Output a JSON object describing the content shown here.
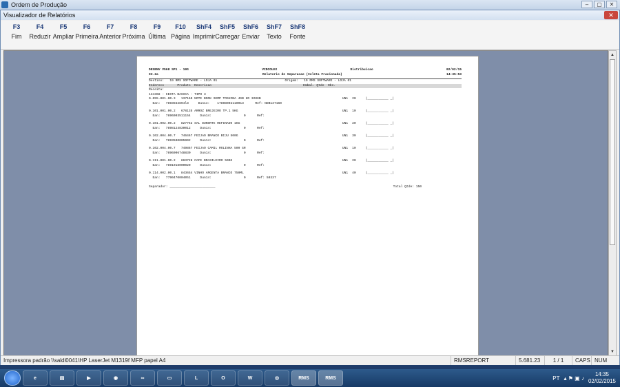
{
  "outer_window": {
    "title": "Ordem de Produção"
  },
  "dialog": {
    "title": "Visualizador de Relatórios"
  },
  "toolbar": [
    {
      "key": "F3",
      "label": "Fim"
    },
    {
      "key": "F4",
      "label": "Reduzir"
    },
    {
      "key": "F5",
      "label": "Ampliar"
    },
    {
      "key": "F6",
      "label": "Primeira"
    },
    {
      "key": "F7",
      "label": "Anterior"
    },
    {
      "key": "F8",
      "label": "Próxima"
    },
    {
      "key": "F9",
      "label": "Última"
    },
    {
      "key": "F10",
      "label": "Página"
    },
    {
      "key": "ShF4",
      "label": "Imprimir"
    },
    {
      "key": "ShF5",
      "label": "Carregar"
    },
    {
      "key": "ShF6",
      "label": "Enviar"
    },
    {
      "key": "ShF7",
      "label": "Texto"
    },
    {
      "key": "ShF8",
      "label": "Fonte"
    }
  ],
  "report": {
    "header_left_1": "DESENV V568 SP1 - 10G",
    "header_mid_1": "VCDCOLEX",
    "header_right_1a": "Distribuicao",
    "header_date": "02/02/15",
    "header_left_2": "03.2a",
    "header_right_2a": "Relatorio de Separacao (Coleta Fracionada)",
    "header_time": "14:35:53",
    "destino": "Destino:   19 RMS SOFTWARE - LOJA 01",
    "origem": "Origem:   19 RMS SOFTWARE - LOJA 01",
    "columns": "Endereco       Produto  Descricao",
    "columns_right": "Embal. Qtde  Obs.",
    "receita": "Receita:",
    "group": "134368 - CESTA  BASICA -  TIPO 3",
    "items": [
      {
        "line1": "0.055.001.00.3   137160 NOTE BOOK SEMP TOSHIBA 4GB HD 320GB",
        "embal": "UN1",
        "qtde": "20",
        "line2": "  Ean:   7893552894l8     Dun14:    17898002110013      Ref: NDB137160"
      },
      {
        "line1": "0.101.001.00.2   678135 ARROZ BREJEIRO TP.1 5KG",
        "embal": "UN1",
        "qtde": "10",
        "line2": "  Ean:   7896003511154     Dun14:                 0      Ref:"
      },
      {
        "line1": "0.101.002.00.2   827762 SAL DUNORTE REFINADO 1KG",
        "embal": "UN1",
        "qtde": "20",
        "line2": "  Ean:   7898124830012     Dun14:                 0      Ref:"
      },
      {
        "line1": "0.102.004.00.7   746467 FEIJAO BRANCO BIJU 500G",
        "embal": "UN1",
        "qtde": "30",
        "line2": "  Ean:   7893500005902     Dun14:                 0      Ref:"
      },
      {
        "line1": "0.102.004.00.7   749867 FEIJAO CAMIL ROLINHA 500 GR",
        "embal": "UN1",
        "qtde": "10",
        "line2": "  Ean:   7896006748830     Dun14:                 0      Ref:"
      },
      {
        "line1": "0.111.001.00.2   863728 CAFE BRASILEIRO 500G",
        "embal": "UN1",
        "qtde": "20",
        "line2": "  Ean:   7891018000020     Dun14:                 0      Ref:"
      },
      {
        "line1": "0.114.002.00.1   843654 VINHO ARGENTA BRANCO 750ML",
        "embal": "UN1",
        "qtde": "40",
        "line2": "  Ean:   7790470004051     Dun14:                 0      Ref: 50337"
      }
    ],
    "obs_blank": "|___________ _|",
    "separador": "Separador: ________________________",
    "total": "Total Qtde: 150"
  },
  "status": {
    "printer": "Impressora padrão \\\\saldl0041\\HP LaserJet M1319f MFP papel A4",
    "report_name": "RMSREPORT",
    "size": "5.681.23",
    "pages": "1 / 1",
    "caps": "CAPS",
    "num": "NUM"
  },
  "taskbar": {
    "apps": [
      "IE",
      "Pasta",
      "Media",
      "Chrome",
      "App",
      "Pasta2",
      "Lync",
      "Outlook",
      "Word",
      "Rede",
      "RMS",
      "RMS"
    ],
    "lang": "PT",
    "time": "14:35",
    "date": "02/02/2015"
  }
}
